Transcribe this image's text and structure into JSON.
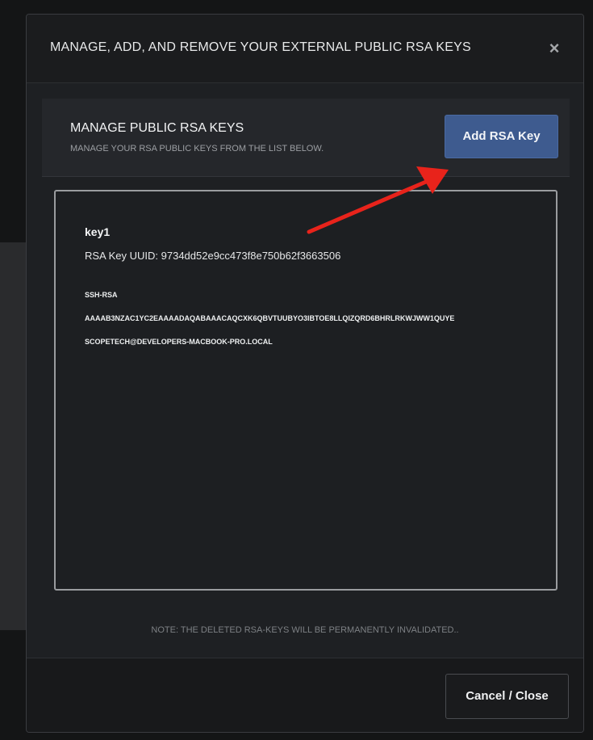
{
  "modal": {
    "title": "MANAGE, ADD, AND REMOVE YOUR EXTERNAL PUBLIC RSA KEYS",
    "close_symbol": "×"
  },
  "section": {
    "title": "MANAGE PUBLIC RSA KEYS",
    "subtitle": "MANAGE YOUR RSA PUBLIC KEYS FROM THE LIST BELOW.",
    "add_button_label": "Add RSA Key"
  },
  "keys": [
    {
      "name": "key1",
      "uuid_text": "RSA Key UUID: 9734dd52e9cc473f8e750b62f3663506",
      "type": "SSH-RSA",
      "key_data": "AAAAB3NZAC1YC2EAAAADAQABAAACAQCXK6QBVTUUBYO3IBTOE8LLQIZQRD6BHRLRKWJWW1QUYE",
      "comment": "SCOPETECH@DEVELOPERS-MACBOOK-PRO.LOCAL"
    }
  ],
  "note": "NOTE: THE DELETED RSA-KEYS WILL BE PERMANENTLY INVALIDATED..",
  "footer": {
    "cancel_label": "Cancel / Close"
  },
  "colors": {
    "accent_button": "#3e5b8f",
    "annotation_arrow": "#e8231b"
  },
  "icons": {
    "close": "close-icon",
    "annotation": "arrow-annotation-icon"
  }
}
